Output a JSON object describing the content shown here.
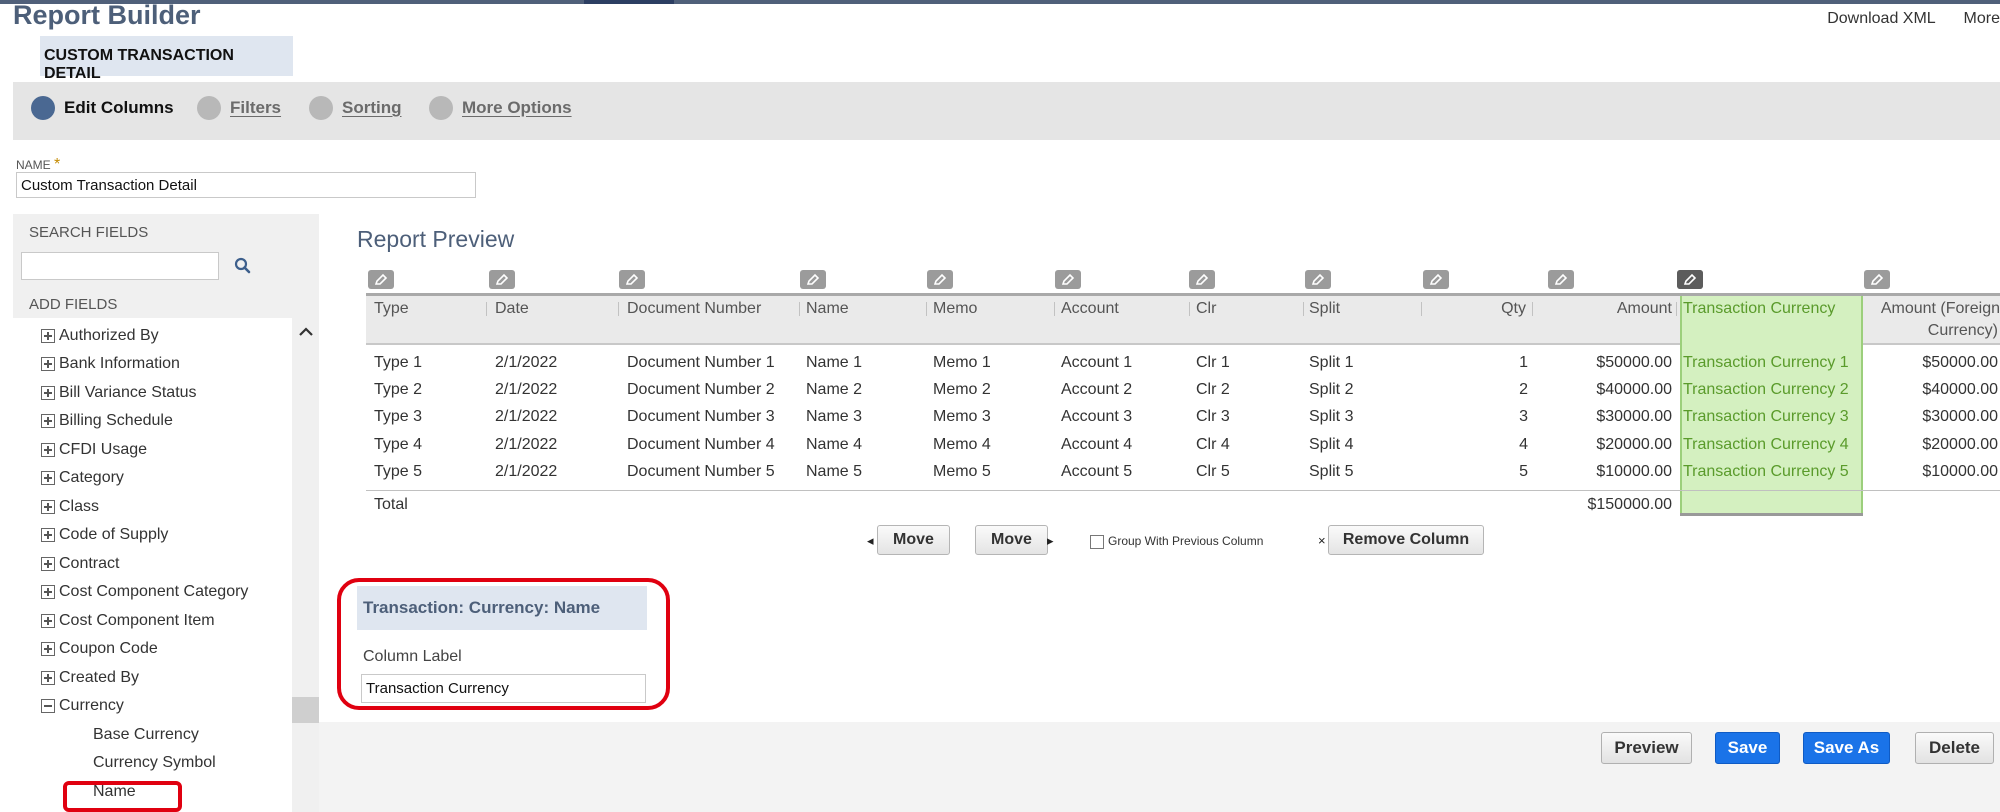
{
  "header": {
    "title": "Report Builder",
    "links": [
      "Download XML",
      "More"
    ],
    "report_tag": "CUSTOM TRANSACTION DETAIL"
  },
  "steps": [
    {
      "label": "Edit Columns",
      "active": true
    },
    {
      "label": "Filters",
      "active": false
    },
    {
      "label": "Sorting",
      "active": false
    },
    {
      "label": "More Options",
      "active": false
    }
  ],
  "name_field": {
    "label": "NAME",
    "required_mark": "*",
    "value": "Custom Transaction Detail"
  },
  "search": {
    "label": "SEARCH FIELDS",
    "value": ""
  },
  "add_fields": {
    "label": "ADD FIELDS",
    "items": [
      {
        "label": "Authorized By",
        "expanded": false
      },
      {
        "label": "Bank Information",
        "expanded": false
      },
      {
        "label": "Bill Variance Status",
        "expanded": false
      },
      {
        "label": "Billing Schedule",
        "expanded": false
      },
      {
        "label": "CFDI Usage",
        "expanded": false
      },
      {
        "label": "Category",
        "expanded": false
      },
      {
        "label": "Class",
        "expanded": false
      },
      {
        "label": "Code of Supply",
        "expanded": false
      },
      {
        "label": "Contract",
        "expanded": false
      },
      {
        "label": "Cost Component Category",
        "expanded": false
      },
      {
        "label": "Cost Component Item",
        "expanded": false
      },
      {
        "label": "Coupon Code",
        "expanded": false
      },
      {
        "label": "Created By",
        "expanded": false
      },
      {
        "label": "Currency",
        "expanded": true
      }
    ],
    "currency_children": [
      "Base Currency",
      "Currency Symbol",
      "Name"
    ]
  },
  "preview": {
    "title": "Report Preview",
    "columns": [
      "Type",
      "Date",
      "Document Number",
      "Name",
      "Memo",
      "Account",
      "Clr",
      "Split",
      "Qty",
      "Amount",
      "Transaction Currency",
      "Amount (Foreign",
      "Currency)"
    ],
    "rows": [
      [
        "Type 1",
        "2/1/2022",
        "Document Number 1",
        "Name 1",
        "Memo 1",
        "Account 1",
        "Clr 1",
        "Split 1",
        "1",
        "$50000.00",
        "Transaction Currency 1",
        "$50000.00"
      ],
      [
        "Type 2",
        "2/1/2022",
        "Document Number 2",
        "Name 2",
        "Memo 2",
        "Account 2",
        "Clr 2",
        "Split 2",
        "2",
        "$40000.00",
        "Transaction Currency 2",
        "$40000.00"
      ],
      [
        "Type 3",
        "2/1/2022",
        "Document Number 3",
        "Name 3",
        "Memo 3",
        "Account 3",
        "Clr 3",
        "Split 3",
        "3",
        "$30000.00",
        "Transaction Currency 3",
        "$30000.00"
      ],
      [
        "Type 4",
        "2/1/2022",
        "Document Number 4",
        "Name 4",
        "Memo 4",
        "Account 4",
        "Clr 4",
        "Split 4",
        "4",
        "$20000.00",
        "Transaction Currency 4",
        "$20000.00"
      ],
      [
        "Type 5",
        "2/1/2022",
        "Document Number 5",
        "Name 5",
        "Memo 5",
        "Account 5",
        "Clr 5",
        "Split 5",
        "5",
        "$10000.00",
        "Transaction Currency 5",
        "$10000.00"
      ]
    ],
    "total_label": "Total",
    "total_amount": "$150000.00"
  },
  "column_actions": {
    "move_left": "Move",
    "move_right": "Move",
    "group_label": "Group With Previous Column",
    "remove": "Remove Column"
  },
  "column_detail": {
    "heading": "Transaction: Currency: Name",
    "label": "Column Label",
    "value": "Transaction Currency"
  },
  "footer_buttons": [
    "Preview",
    "Save",
    "Save As",
    "Delete"
  ],
  "colors": {
    "accent": "#4d5f79",
    "selected_column": "#d4f0c0",
    "primary_button": "#1a73e8",
    "highlight_annotation": "#e00010"
  }
}
